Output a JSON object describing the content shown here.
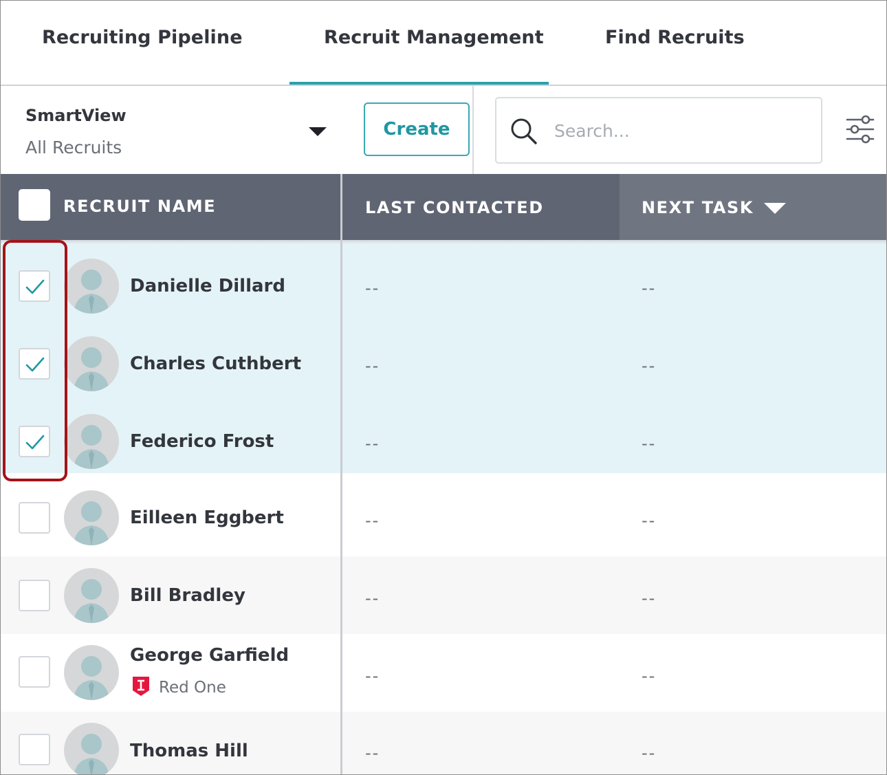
{
  "tabs": [
    {
      "label": "Recruiting Pipeline",
      "active": false
    },
    {
      "label": "Recruit Management",
      "active": true
    },
    {
      "label": "Find Recruits",
      "active": false
    }
  ],
  "toolbar": {
    "smartview_label": "SmartView",
    "smartview_value": "All Recruits",
    "create_label": "Create",
    "search_placeholder": "Search...",
    "search_value": ""
  },
  "table": {
    "columns": [
      "RECRUIT NAME",
      "LAST CONTACTED",
      "NEXT TASK"
    ],
    "rows": [
      {
        "name": "Danielle Dillard",
        "subtitle": "",
        "last_contacted": "--",
        "next_task": "--",
        "selected": true
      },
      {
        "name": "Charles Cuthbert",
        "subtitle": "",
        "last_contacted": "--",
        "next_task": "--",
        "selected": true
      },
      {
        "name": "Federico Frost",
        "subtitle": "",
        "last_contacted": "--",
        "next_task": "--",
        "selected": true
      },
      {
        "name": "Eilleen Eggbert",
        "subtitle": "",
        "last_contacted": "--",
        "next_task": "--",
        "selected": false
      },
      {
        "name": "Bill Bradley",
        "subtitle": "",
        "last_contacted": "--",
        "next_task": "--",
        "selected": false
      },
      {
        "name": "George Garfield",
        "subtitle": "Red One",
        "last_contacted": "--",
        "next_task": "--",
        "selected": false
      },
      {
        "name": "Thomas Hill",
        "subtitle": "",
        "last_contacted": "--",
        "next_task": "--",
        "selected": false
      }
    ]
  },
  "colors": {
    "accent": "#28a2ac",
    "header_bg": "#5f6573",
    "selected_row_bg": "#e4f3f7",
    "highlight_box": "#a51218",
    "badge_red": "#e5173f",
    "avatar_figure": "#a9c6ca"
  },
  "icons": {
    "search": "search-icon",
    "filter": "filter-sliders-icon",
    "dropdown": "caret-down-icon",
    "avatar": "person-silhouette-icon",
    "badge": "shield-badge-icon",
    "check": "checkmark-icon"
  }
}
